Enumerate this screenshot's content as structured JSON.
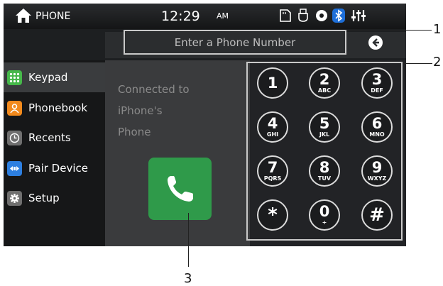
{
  "status_bar": {
    "title": "PHONE",
    "time": "12:29",
    "ampm": "AM"
  },
  "input": {
    "placeholder": "Enter a Phone Number"
  },
  "sidebar": {
    "items": [
      {
        "label": "Keypad",
        "icon": "keypad-grid-icon",
        "color": "#46b84a"
      },
      {
        "label": "Phonebook",
        "icon": "phonebook-icon",
        "color": "#f28a1d"
      },
      {
        "label": "Recents",
        "icon": "clock-icon",
        "color": "#7a7a7a"
      },
      {
        "label": "Pair Device",
        "icon": "pair-device-icon",
        "color": "#2d7fe0"
      },
      {
        "label": "Setup",
        "icon": "gear-icon",
        "color": "#7a7a7a"
      }
    ]
  },
  "connection": {
    "line1": "Connected to",
    "line2": "iPhone's",
    "line3": "Phone"
  },
  "keypad": {
    "keys": [
      {
        "digit": "1",
        "letters": ""
      },
      {
        "digit": "2",
        "letters": "ABC"
      },
      {
        "digit": "3",
        "letters": "DEF"
      },
      {
        "digit": "4",
        "letters": "GHI"
      },
      {
        "digit": "5",
        "letters": "JKL"
      },
      {
        "digit": "6",
        "letters": "MNO"
      },
      {
        "digit": "7",
        "letters": "PQRS"
      },
      {
        "digit": "8",
        "letters": "TUV"
      },
      {
        "digit": "9",
        "letters": "WXYZ"
      },
      {
        "digit": "*",
        "letters": ""
      },
      {
        "digit": "0",
        "letters": "+"
      },
      {
        "digit": "#",
        "letters": ""
      }
    ]
  },
  "callouts": [
    "1",
    "2",
    "3"
  ],
  "colors": {
    "call_green": "#2f9a4a",
    "bluetooth_blue": "#1e6fd9",
    "active_item": "#3a3c3e"
  }
}
